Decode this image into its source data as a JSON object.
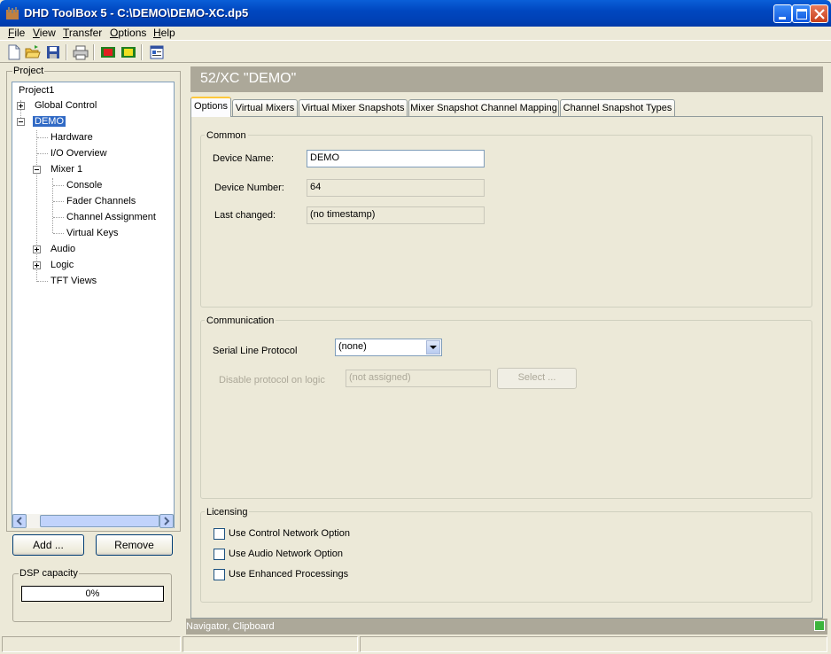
{
  "window": {
    "title": "DHD ToolBox 5 - C:\\DEMO\\DEMO-XC.dp5"
  },
  "menu": [
    {
      "label": "File",
      "key": "F"
    },
    {
      "label": "View",
      "key": "V"
    },
    {
      "label": "Transfer",
      "key": "T"
    },
    {
      "label": "Options",
      "key": "O"
    },
    {
      "label": "Help",
      "key": "H"
    }
  ],
  "menu_labels": {
    "file": "File",
    "view": "View",
    "transfer": "Transfer",
    "options": "Options",
    "help": "Help"
  },
  "project": {
    "label": "Project",
    "tree": {
      "root": "Project1",
      "global_control": "Global Control",
      "demo": "DEMO",
      "hardware": "Hardware",
      "io_overview": "I/O Overview",
      "mixer1": "Mixer 1",
      "console": "Console",
      "fader_channels": "Fader Channels",
      "channel_assignment": "Channel Assignment",
      "virtual_keys": "Virtual Keys",
      "audio": "Audio",
      "logic": "Logic",
      "tft_views": "TFT Views"
    },
    "add_label": "Add ...",
    "remove_label": "Remove",
    "dsp_label": "DSP capacity",
    "dsp_value": "0%"
  },
  "main": {
    "header": "52/XC \"DEMO\"",
    "tabs": {
      "options": "Options",
      "virtual_mixers": "Virtual Mixers",
      "vm_snapshots": "Virtual Mixer Snapshots",
      "mixer_snapshot_mapping": "Mixer Snapshot Channel Mapping",
      "channel_snapshot_types": "Channel Snapshot Types"
    },
    "common": {
      "label": "Common",
      "device_name_label": "Device Name:",
      "device_name_value": "DEMO",
      "device_number_label": "Device Number:",
      "device_number_value": "64",
      "last_changed_label": "Last changed:",
      "last_changed_value": "(no timestamp)"
    },
    "communication": {
      "label": "Communication",
      "serial_label": "Serial Line Protocol",
      "serial_value": "(none)",
      "disable_label": "Disable protocol on logic",
      "disable_value": "(not assigned)",
      "select_label": "Select ..."
    },
    "licensing": {
      "label": "Licensing",
      "opt1": "Use Control Network Option",
      "opt2": "Use Audio Network Option",
      "opt3": "Use Enhanced Processings"
    }
  },
  "navigator": {
    "label": "Navigator, Clipboard"
  }
}
